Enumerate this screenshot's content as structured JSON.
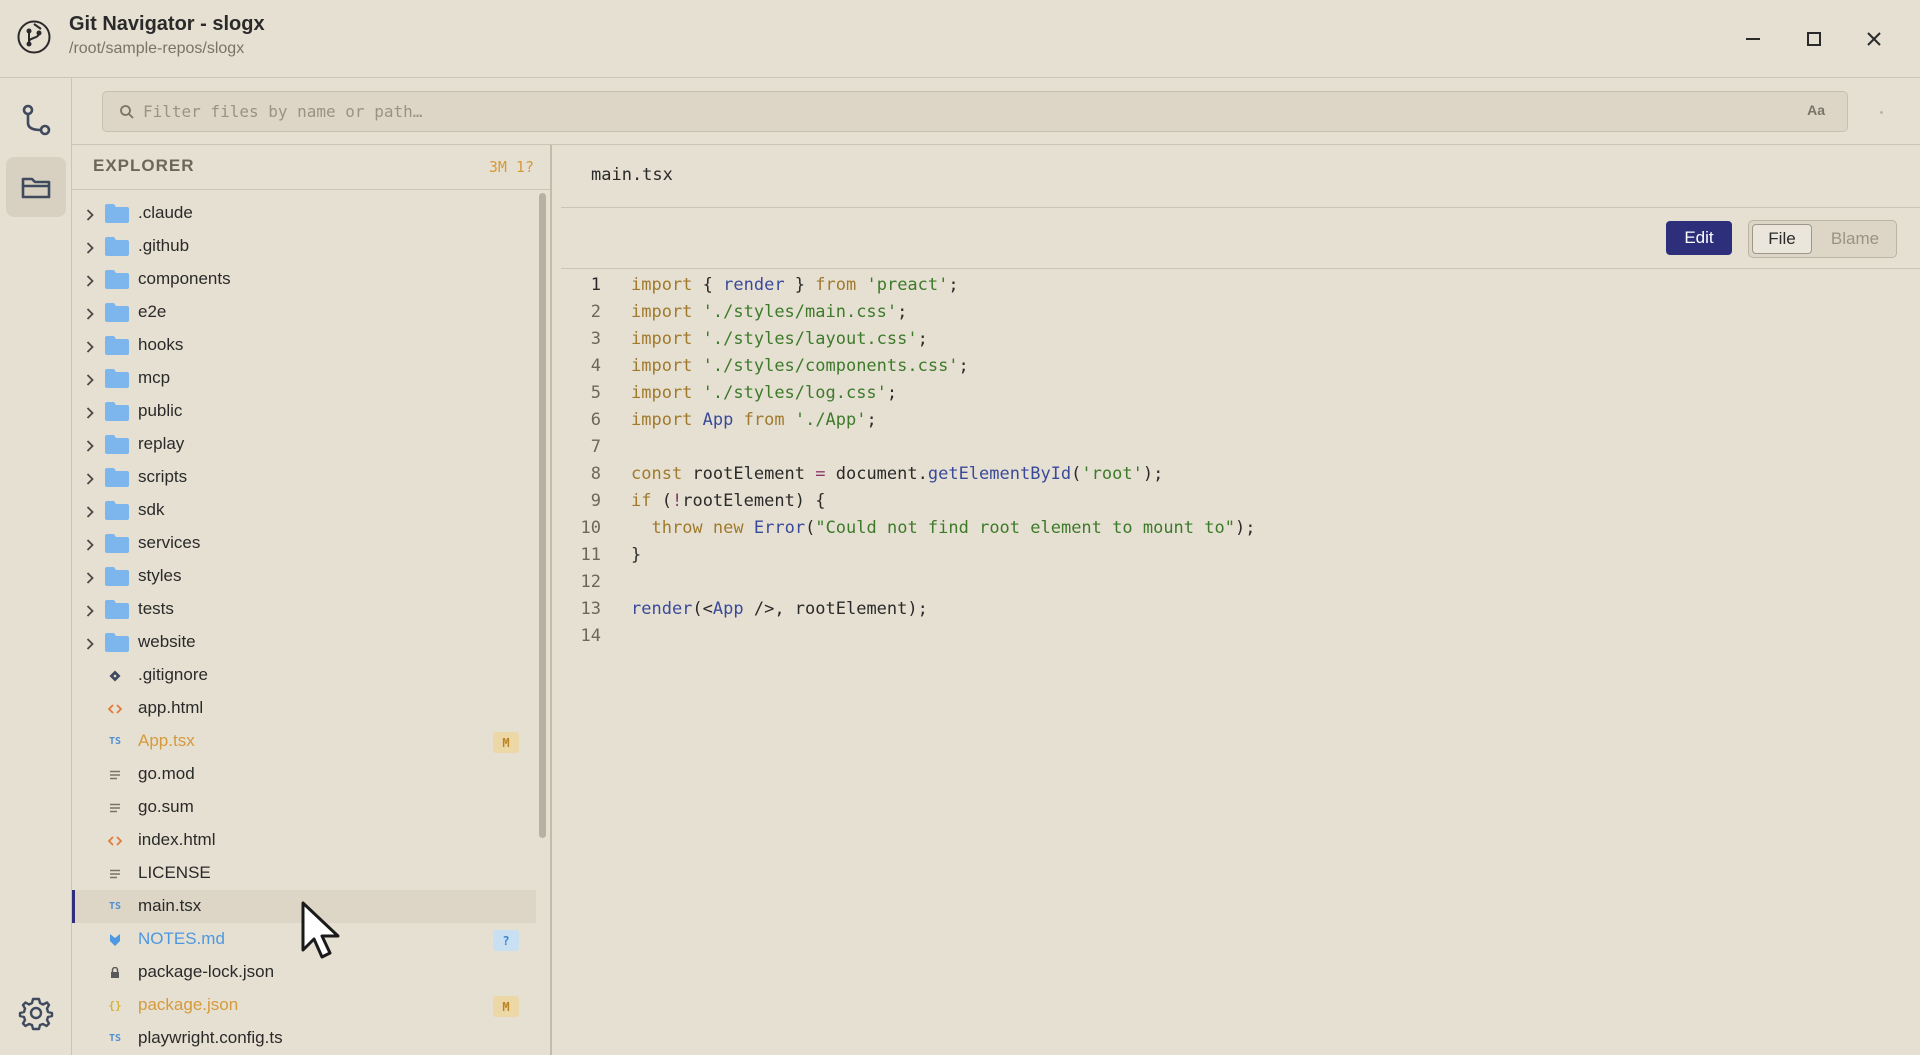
{
  "window": {
    "title": "Git Navigator - slogx",
    "path": "/root/sample-repos/slogx"
  },
  "filter": {
    "placeholder": "Filter files by name or path…",
    "value": "",
    "case_toggle": "Aa"
  },
  "explorer": {
    "title": "EXPLORER",
    "status": "3M 1?",
    "items": [
      {
        "name": ".claude",
        "type": "folder"
      },
      {
        "name": ".github",
        "type": "folder"
      },
      {
        "name": "components",
        "type": "folder"
      },
      {
        "name": "e2e",
        "type": "folder"
      },
      {
        "name": "hooks",
        "type": "folder"
      },
      {
        "name": "mcp",
        "type": "folder"
      },
      {
        "name": "public",
        "type": "folder"
      },
      {
        "name": "replay",
        "type": "folder"
      },
      {
        "name": "scripts",
        "type": "folder"
      },
      {
        "name": "sdk",
        "type": "folder"
      },
      {
        "name": "services",
        "type": "folder"
      },
      {
        "name": "styles",
        "type": "folder"
      },
      {
        "name": "tests",
        "type": "folder"
      },
      {
        "name": "website",
        "type": "folder"
      },
      {
        "name": ".gitignore",
        "type": "file",
        "icon": "git-diamond-icon"
      },
      {
        "name": "app.html",
        "type": "file",
        "icon": "html-icon"
      },
      {
        "name": "App.tsx",
        "type": "file",
        "icon": "typescript-icon",
        "status": "M"
      },
      {
        "name": "go.mod",
        "type": "file",
        "icon": "text-lines-icon"
      },
      {
        "name": "go.sum",
        "type": "file",
        "icon": "text-lines-icon"
      },
      {
        "name": "index.html",
        "type": "file",
        "icon": "html-icon"
      },
      {
        "name": "LICENSE",
        "type": "file",
        "icon": "text-lines-icon"
      },
      {
        "name": "main.tsx",
        "type": "file",
        "icon": "typescript-icon",
        "selected": true
      },
      {
        "name": "NOTES.md",
        "type": "file",
        "icon": "markdown-icon",
        "status": "?"
      },
      {
        "name": "package-lock.json",
        "type": "file",
        "icon": "lock-icon"
      },
      {
        "name": "package.json",
        "type": "file",
        "icon": "json-icon",
        "status": "M"
      },
      {
        "name": "playwright.config.ts",
        "type": "file",
        "icon": "typescript-icon"
      }
    ]
  },
  "editor": {
    "filename": "main.tsx",
    "edit_label": "Edit",
    "file_label": "File",
    "blame_label": "Blame",
    "current_line": 1,
    "lines": [
      "import { render } from 'preact';",
      "import './styles/main.css';",
      "import './styles/layout.css';",
      "import './styles/components.css';",
      "import './styles/log.css';",
      "import App from './App';",
      "",
      "const rootElement = document.getElementById('root');",
      "if (!rootElement) {",
      "  throw new Error(\"Could not find root element to mount to\");",
      "}",
      "",
      "render(<App />, rootElement);",
      ""
    ]
  },
  "colors": {
    "accent": "#2d2f7a",
    "modified": "#d59a3c",
    "untracked": "#4d98e2",
    "folder": "#7cb6ec",
    "background": "#e6e0d2"
  }
}
